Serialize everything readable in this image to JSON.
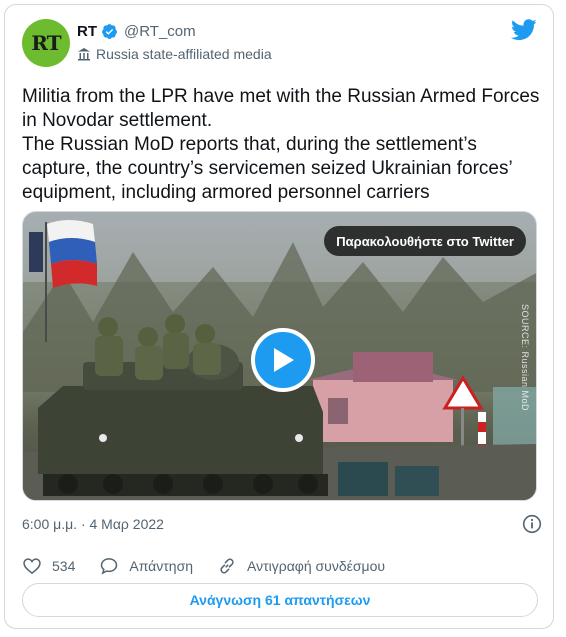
{
  "account": {
    "avatar_text": "RT",
    "display_name": "RT",
    "handle": "@RT_com",
    "label": "Russia state-affiliated media"
  },
  "tweet": {
    "text": "Militia from the LPR have met with the Russian Armed Forces in Novodar settlement.\nThe Russian MoD reports that, during the settlement’s capture, the country’s servicemen seized Ukrainian forces’ equipment, including armored personnel carriers"
  },
  "media": {
    "watch_label": "Παρακολουθήστε στο Twitter",
    "source_tag": "SOURCE: Russian MoD"
  },
  "meta": {
    "timestamp": "6:00 μ.μ. · 4 Μαρ 2022"
  },
  "actions": {
    "likes_count": "534",
    "reply_label": "Απάντηση",
    "copy_link_label": "Αντιγραφή συνδέσμου"
  },
  "read_replies_label": "Ανάγνωση 61 απαντήσεων",
  "colors": {
    "accent": "#1d9bf0",
    "avatar_bg": "#6dbb2e",
    "secondary_text": "#536471"
  }
}
